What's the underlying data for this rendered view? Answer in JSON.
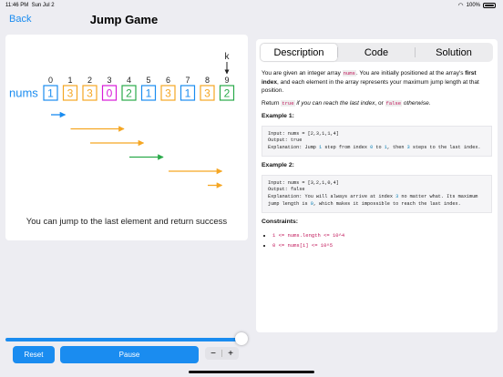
{
  "status_bar": {
    "time": "11:46 PM",
    "date": "Sun Jul 2",
    "battery": "100%"
  },
  "nav": {
    "back_label": "Back",
    "title": "Jump Game"
  },
  "visualization": {
    "array_label": "nums",
    "values": [
      "1",
      "3",
      "3",
      "0",
      "2",
      "1",
      "3",
      "1",
      "3",
      "2"
    ],
    "indices": [
      "0",
      "1",
      "2",
      "3",
      "4",
      "5",
      "6",
      "7",
      "8",
      "9"
    ],
    "pointer_label": "k",
    "pointer_index": 9,
    "value_colors": [
      "#1a8cf0",
      "#f5a623",
      "#f5a623",
      "#d81bd8",
      "#2aaa4a",
      "#1a8cf0",
      "#f5a623",
      "#1a8cf0",
      "#f5a623",
      "#2aaa4a"
    ],
    "jumps": [
      {
        "from": 0,
        "to": 1,
        "color": "#1a8cf0"
      },
      {
        "from": 1,
        "to": 4,
        "color": "#f5a623"
      },
      {
        "from": 2,
        "to": 5,
        "color": "#f5a623"
      },
      {
        "from": 4,
        "to": 6,
        "color": "#2aaa4a"
      },
      {
        "from": 6,
        "to": 9,
        "color": "#f5a623"
      },
      {
        "from": 8,
        "to": 9,
        "color": "#f5a623"
      }
    ],
    "message": "You can jump to the last element and return success"
  },
  "tabs": [
    "Description",
    "Code",
    "Solution"
  ],
  "active_tab": 0,
  "description": {
    "p1_a": "You are given an integer array ",
    "p1_code": "nums",
    "p1_b": ". You are initially positioned at the array's ",
    "p1_bold": "first index",
    "p1_c": ", and each element in the array represents your maximum jump length at that position.",
    "p2_a": "Return ",
    "p2_code1": "true",
    "p2_b": " if you can reach the last index",
    "p2_c": ", or ",
    "p2_code2": "false",
    "p2_d": " otherwise.",
    "ex1_heading": "Example 1:",
    "ex1_input": "Input: nums = [2,3,1,1,4]",
    "ex1_output": "Output: true",
    "ex1_expl_a": "Explanation: Jump ",
    "ex1_expl_n1": "1",
    "ex1_expl_b": " step from index ",
    "ex1_expl_n2": "0",
    "ex1_expl_c": " to ",
    "ex1_expl_n3": "1",
    "ex1_expl_d": ", then ",
    "ex1_expl_n4": "3",
    "ex1_expl_e": " steps to the last index.",
    "ex2_heading": "Example 2:",
    "ex2_input": "Input: nums = [3,2,1,0,4]",
    "ex2_output": "Output: false",
    "ex2_expl_a": "Explanation: You will always arrive at index ",
    "ex2_expl_n1": "3",
    "ex2_expl_b": " no matter what. Its maximum jump length is ",
    "ex2_expl_n2": "0",
    "ex2_expl_c": ", which makes it impossible to reach the last index.",
    "constraints_heading": "Constraints:",
    "constraints": [
      "1 <= nums.length <= 10^4",
      "0 <= nums[i] <= 10^5"
    ]
  },
  "controls": {
    "reset_label": "Reset",
    "pause_label": "Pause",
    "minus_label": "−",
    "plus_label": "+",
    "progress": 1.0
  },
  "colors": {
    "accent": "#1a8cf0"
  }
}
